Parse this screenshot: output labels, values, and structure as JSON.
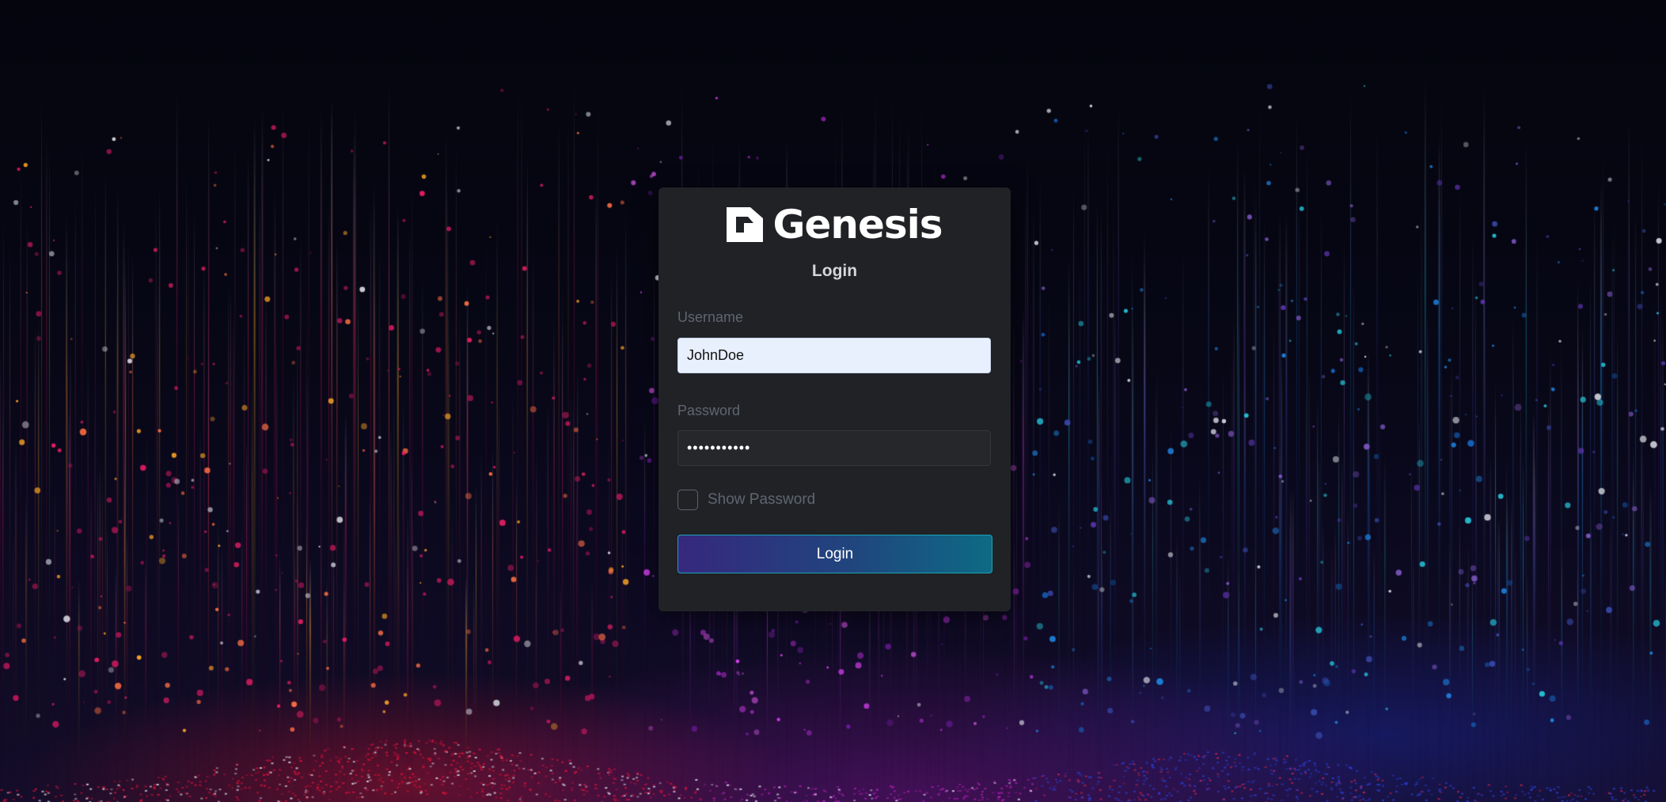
{
  "brand": {
    "name": "Genesis",
    "logo_icon": "genesis-logo-mark"
  },
  "login_card": {
    "title": "Login",
    "username": {
      "label": "Username",
      "value": "JohnDoe"
    },
    "password": {
      "label": "Password",
      "value": "•••••••••••"
    },
    "show_password": {
      "label": "Show Password",
      "checked": false
    },
    "submit_label": "Login"
  },
  "colors": {
    "card_background": "#212226",
    "autofill_background": "#e8f0fe",
    "button_gradient_start": "#36287e",
    "button_gradient_end": "#0d6a84",
    "button_border": "#1aa3b7"
  }
}
